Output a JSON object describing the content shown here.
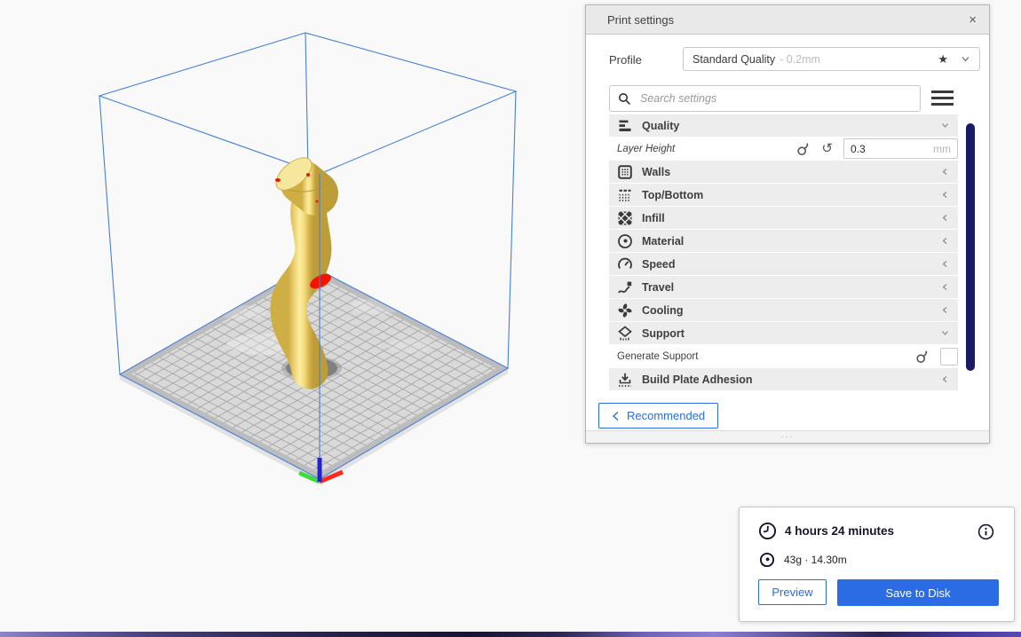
{
  "print_settings": {
    "title": "Print settings",
    "profile": {
      "label": "Profile",
      "value": "Standard Quality",
      "detail": "- 0.2mm"
    },
    "search_placeholder": "Search settings",
    "rows": [
      {
        "label": "Quality",
        "type": "category",
        "state": "expanded"
      },
      {
        "label": "Layer Height",
        "type": "setting",
        "value": "0.3",
        "unit": "mm"
      },
      {
        "label": "Walls",
        "type": "category",
        "state": "collapsed"
      },
      {
        "label": "Top/Bottom",
        "type": "category",
        "state": "collapsed"
      },
      {
        "label": "Infill",
        "type": "category",
        "state": "collapsed"
      },
      {
        "label": "Material",
        "type": "category",
        "state": "collapsed"
      },
      {
        "label": "Speed",
        "type": "category",
        "state": "collapsed"
      },
      {
        "label": "Travel",
        "type": "category",
        "state": "collapsed"
      },
      {
        "label": "Cooling",
        "type": "category",
        "state": "collapsed"
      },
      {
        "label": "Support",
        "type": "category",
        "state": "expanded"
      },
      {
        "label": "Generate Support",
        "type": "setting",
        "checked": false
      },
      {
        "label": "Build Plate Adhesion",
        "type": "category",
        "state": "collapsed"
      }
    ],
    "recommended_label": "Recommended"
  },
  "action_panel": {
    "print_time": "4 hours 24 minutes",
    "material_estimate": "43g · 14.30m",
    "preview_label": "Preview",
    "save_label": "Save to Disk"
  },
  "icons": {
    "close": "×",
    "star": "★",
    "revert": "↺",
    "drag_handle": "···"
  },
  "colors": {
    "accent_blue": "#2b6ce5",
    "scrollbar_navy": "#1a1a66",
    "wireframe_blue": "#4680d8",
    "model_yellow": "#f2d564",
    "overhang_red": "#f61300",
    "axis_x_red": "#ff2a1a",
    "axis_y_green": "#3ddc3d",
    "axis_z_blue": "#2222cc"
  }
}
